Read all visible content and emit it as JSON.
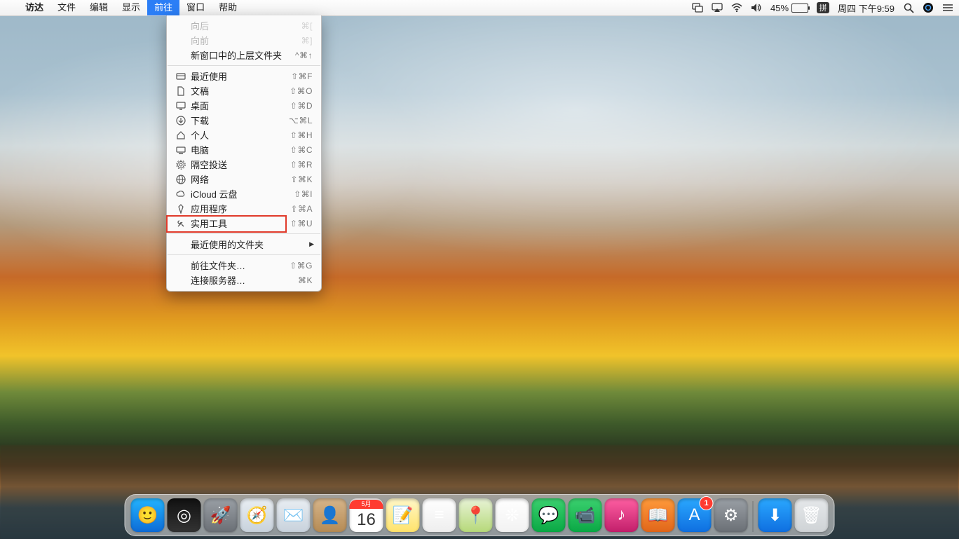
{
  "menubar": {
    "apple": "",
    "app": "访达",
    "items": [
      "文件",
      "编辑",
      "显示",
      "前往",
      "窗口",
      "帮助"
    ],
    "active_index": 3
  },
  "status": {
    "battery_pct": "45%",
    "ime": "拼",
    "datetime": "周四 下午9:59"
  },
  "dropdown": {
    "groups": [
      [
        {
          "label": "向后",
          "shortcut": "⌘[",
          "disabled": true,
          "icon": ""
        },
        {
          "label": "向前",
          "shortcut": "⌘]",
          "disabled": true,
          "icon": ""
        },
        {
          "label": "新窗口中的上层文件夹",
          "shortcut": "^⌘↑",
          "icon": ""
        }
      ],
      [
        {
          "label": "最近使用",
          "shortcut": "⇧⌘F",
          "icon": "recents"
        },
        {
          "label": "文稿",
          "shortcut": "⇧⌘O",
          "icon": "documents"
        },
        {
          "label": "桌面",
          "shortcut": "⇧⌘D",
          "icon": "desktop"
        },
        {
          "label": "下载",
          "shortcut": "⌥⌘L",
          "icon": "downloads"
        },
        {
          "label": "个人",
          "shortcut": "⇧⌘H",
          "icon": "home"
        },
        {
          "label": "电脑",
          "shortcut": "⇧⌘C",
          "icon": "computer"
        },
        {
          "label": "隔空投送",
          "shortcut": "⇧⌘R",
          "icon": "airdrop"
        },
        {
          "label": "网络",
          "shortcut": "⇧⌘K",
          "icon": "network"
        },
        {
          "label": "iCloud 云盘",
          "shortcut": "⇧⌘I",
          "icon": "icloud"
        },
        {
          "label": "应用程序",
          "shortcut": "⇧⌘A",
          "icon": "applications"
        },
        {
          "label": "实用工具",
          "shortcut": "⇧⌘U",
          "icon": "utilities",
          "highlight": true
        }
      ],
      [
        {
          "label": "最近使用的文件夹",
          "submenu": true,
          "icon": ""
        }
      ],
      [
        {
          "label": "前往文件夹…",
          "shortcut": "⇧⌘G",
          "icon": ""
        },
        {
          "label": "连接服务器…",
          "shortcut": "⌘K",
          "icon": ""
        }
      ]
    ]
  },
  "dock": {
    "calendar_day": "16",
    "calendar_month": "5月",
    "appstore_badge": "1",
    "items": [
      {
        "name": "finder",
        "bg1": "#23b4ff",
        "bg2": "#0d6bd6",
        "glyph": "🙂"
      },
      {
        "name": "siri",
        "bg1": "#111",
        "bg2": "#333",
        "glyph": "◎"
      },
      {
        "name": "launchpad",
        "bg1": "#9aa0a6",
        "bg2": "#6b7076",
        "glyph": "🚀"
      },
      {
        "name": "safari",
        "bg1": "#e9eef3",
        "bg2": "#c8d2dc",
        "glyph": "🧭"
      },
      {
        "name": "mail",
        "bg1": "#e9eef3",
        "bg2": "#c8d2dc",
        "glyph": "✉️"
      },
      {
        "name": "contacts",
        "bg1": "#d7b58a",
        "bg2": "#b58b55",
        "glyph": "👤"
      },
      {
        "name": "calendar",
        "bg1": "#ffffff",
        "bg2": "#f0f0f0",
        "glyph": ""
      },
      {
        "name": "notes",
        "bg1": "#fff7c8",
        "bg2": "#ffe36b",
        "glyph": "📝"
      },
      {
        "name": "reminders",
        "bg1": "#ffffff",
        "bg2": "#eeeeee",
        "glyph": "≡"
      },
      {
        "name": "maps",
        "bg1": "#e8f3d7",
        "bg2": "#b6d97a",
        "glyph": "📍"
      },
      {
        "name": "photos",
        "bg1": "#ffffff",
        "bg2": "#f2f2f2",
        "glyph": "❊"
      },
      {
        "name": "messages",
        "bg1": "#3bd16f",
        "bg2": "#0aa845",
        "glyph": "💬"
      },
      {
        "name": "facetime",
        "bg1": "#3bd16f",
        "bg2": "#0aa845",
        "glyph": "📹"
      },
      {
        "name": "itunes",
        "bg1": "#ff5fa2",
        "bg2": "#c21f6b",
        "glyph": "♪"
      },
      {
        "name": "ibooks",
        "bg1": "#ff9a3b",
        "bg2": "#e0661a",
        "glyph": "📖"
      },
      {
        "name": "appstore",
        "bg1": "#2aa8ff",
        "bg2": "#0f6fe0",
        "glyph": "A",
        "badge": true
      },
      {
        "name": "preferences",
        "bg1": "#9aa0a6",
        "bg2": "#6b7076",
        "glyph": "⚙"
      }
    ],
    "right_items": [
      {
        "name": "downloads-stack",
        "bg1": "#2aa8ff",
        "bg2": "#0f6fe0",
        "glyph": "⬇"
      },
      {
        "name": "trash",
        "bg1": "#e5e8ea",
        "bg2": "#cfd3d6",
        "glyph": "🗑"
      }
    ]
  }
}
